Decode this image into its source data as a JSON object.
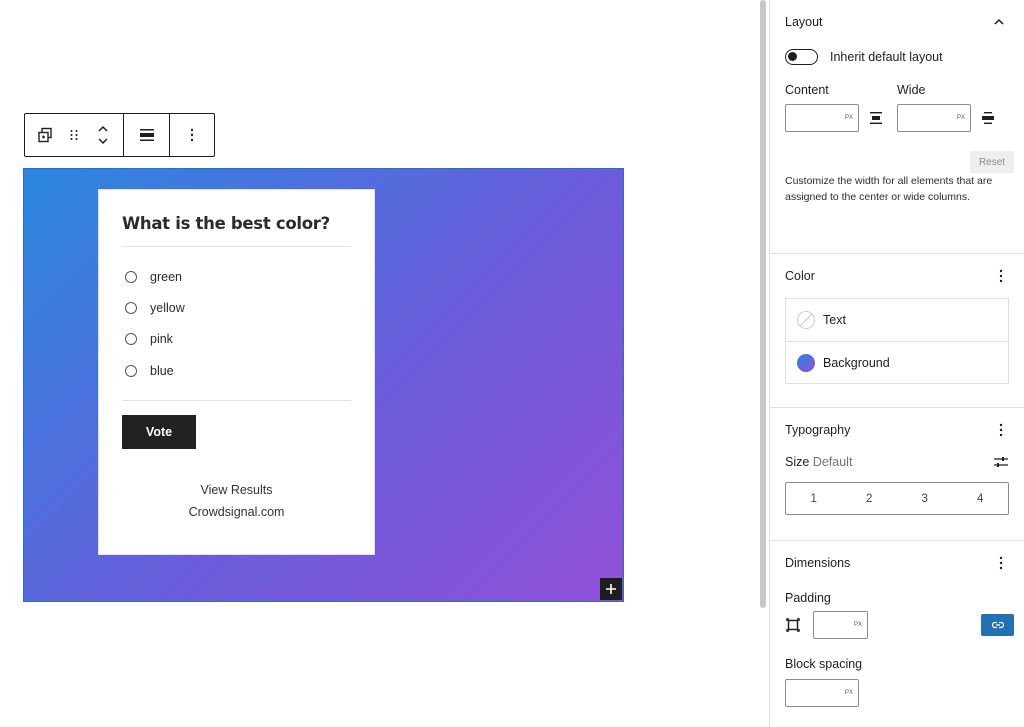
{
  "poll": {
    "question": "What is the best color?",
    "options": [
      "green",
      "yellow",
      "pink",
      "blue"
    ],
    "vote_label": "Vote",
    "results_link": "View Results",
    "brand_link": "Crowdsignal.com"
  },
  "cover": {
    "gradient_start": "#2a87e0",
    "gradient_end": "#9050d8",
    "add_label": "+"
  },
  "toolbar": {
    "icons": [
      "transform-icon",
      "drag-handle-icon",
      "move-up-down-icon",
      "align-icon",
      "more-options-icon"
    ]
  },
  "sidebar": {
    "layout": {
      "title": "Layout",
      "inherit_label": "Inherit default layout",
      "inherit_enabled": false,
      "content_label": "Content",
      "wide_label": "Wide",
      "unit": "PX",
      "reset_label": "Reset",
      "help": "Customize the width for all elements that are assigned to the center or wide columns."
    },
    "color": {
      "title": "Color",
      "items": [
        {
          "label": "Text"
        },
        {
          "label": "Background"
        }
      ]
    },
    "typography": {
      "title": "Typography",
      "size_label": "Size",
      "size_value": "Default",
      "sizes": [
        "1",
        "2",
        "3",
        "4"
      ]
    },
    "dimensions": {
      "title": "Dimensions",
      "padding_label": "Padding",
      "unit": "PX",
      "spacing_label": "Block spacing"
    }
  }
}
